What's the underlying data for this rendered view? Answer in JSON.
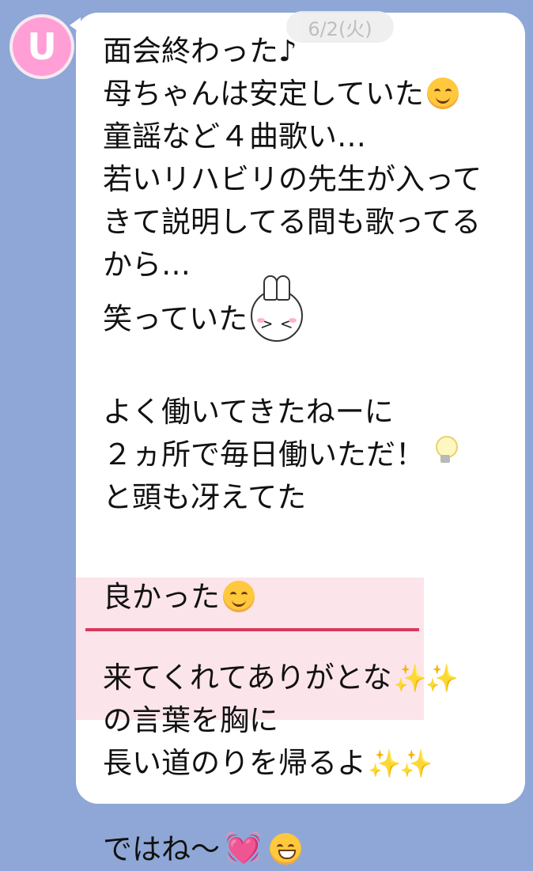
{
  "avatar": {
    "letter": "U"
  },
  "timestamp": "6/2(火)",
  "message": {
    "lines": [
      "面会終わった♪",
      "母ちゃんは安定していた",
      "童謡など４曲歌い…",
      "若いリハビリの先生が入って",
      "きて説明してる間も歌ってる",
      "から…",
      "笑っていた",
      "",
      "よく働いてきたねーに",
      "２ヵ所で毎日働いただ！",
      "と頭も冴えてた",
      "",
      "良かった",
      "",
      "来てくれてありがとな",
      "の言葉を胸に",
      "長い道のりを帰るよ",
      "",
      "ではね〜"
    ]
  },
  "emoji": {
    "sparkles": "✨✨",
    "heart": "💓"
  },
  "colors": {
    "background": "#8ea7d6",
    "bubble": "#ffffff",
    "avatar": "#ff9fd6",
    "highlight": "#fbe4ea",
    "underline": "#d93a5c"
  }
}
